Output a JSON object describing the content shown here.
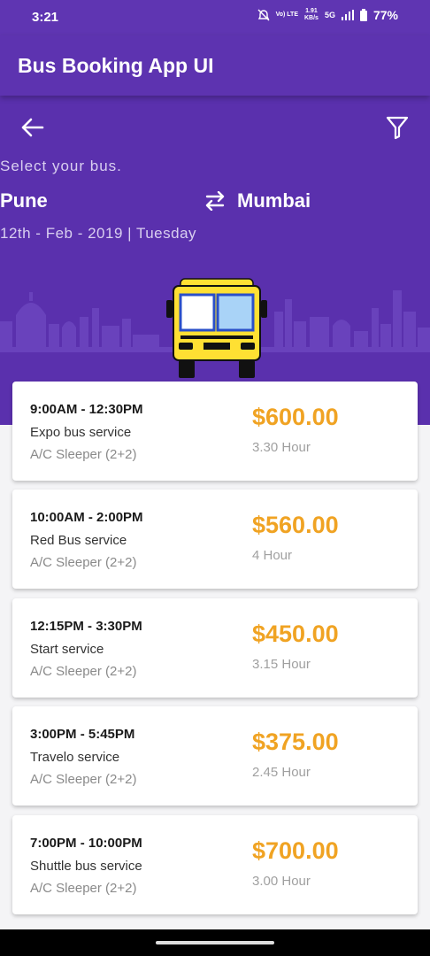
{
  "status_bar": {
    "time": "3:21",
    "volte_top": "Vo) LTE",
    "speed_top": "1.91",
    "speed_bottom": "KB/s",
    "network": "5G",
    "battery": "77%"
  },
  "app_bar": {
    "title": "Bus Booking App UI"
  },
  "hero": {
    "select_label": "Select your bus.",
    "from": "Pune",
    "to": "Mumbai",
    "date": "12th - Feb - 2019 | Tuesday"
  },
  "icons": {
    "back": "arrow-left-icon",
    "filter": "filter-icon",
    "swap": "swap-icon"
  },
  "colors": {
    "primary": "#5d33b0",
    "price": "#f0a323",
    "bus_yellow": "#ffe033",
    "bus_window": "#a9d3f7"
  },
  "buses": [
    {
      "time": "9:00AM - 12:30PM",
      "name": "Expo bus service",
      "seat": "A/C Sleeper (2+2)",
      "price": "$600.00",
      "duration": "3.30 Hour"
    },
    {
      "time": "10:00AM - 2:00PM",
      "name": "Red Bus service",
      "seat": "A/C Sleeper (2+2)",
      "price": "$560.00",
      "duration": "4 Hour"
    },
    {
      "time": "12:15PM - 3:30PM",
      "name": "Start service",
      "seat": "A/C Sleeper (2+2)",
      "price": "$450.00",
      "duration": "3.15 Hour"
    },
    {
      "time": "3:00PM - 5:45PM",
      "name": "Travelo service",
      "seat": "A/C Sleeper (2+2)",
      "price": "$375.00",
      "duration": "2.45 Hour"
    },
    {
      "time": "7:00PM - 10:00PM",
      "name": "Shuttle bus service",
      "seat": "A/C Sleeper (2+2)",
      "price": "$700.00",
      "duration": "3.00 Hour"
    }
  ]
}
